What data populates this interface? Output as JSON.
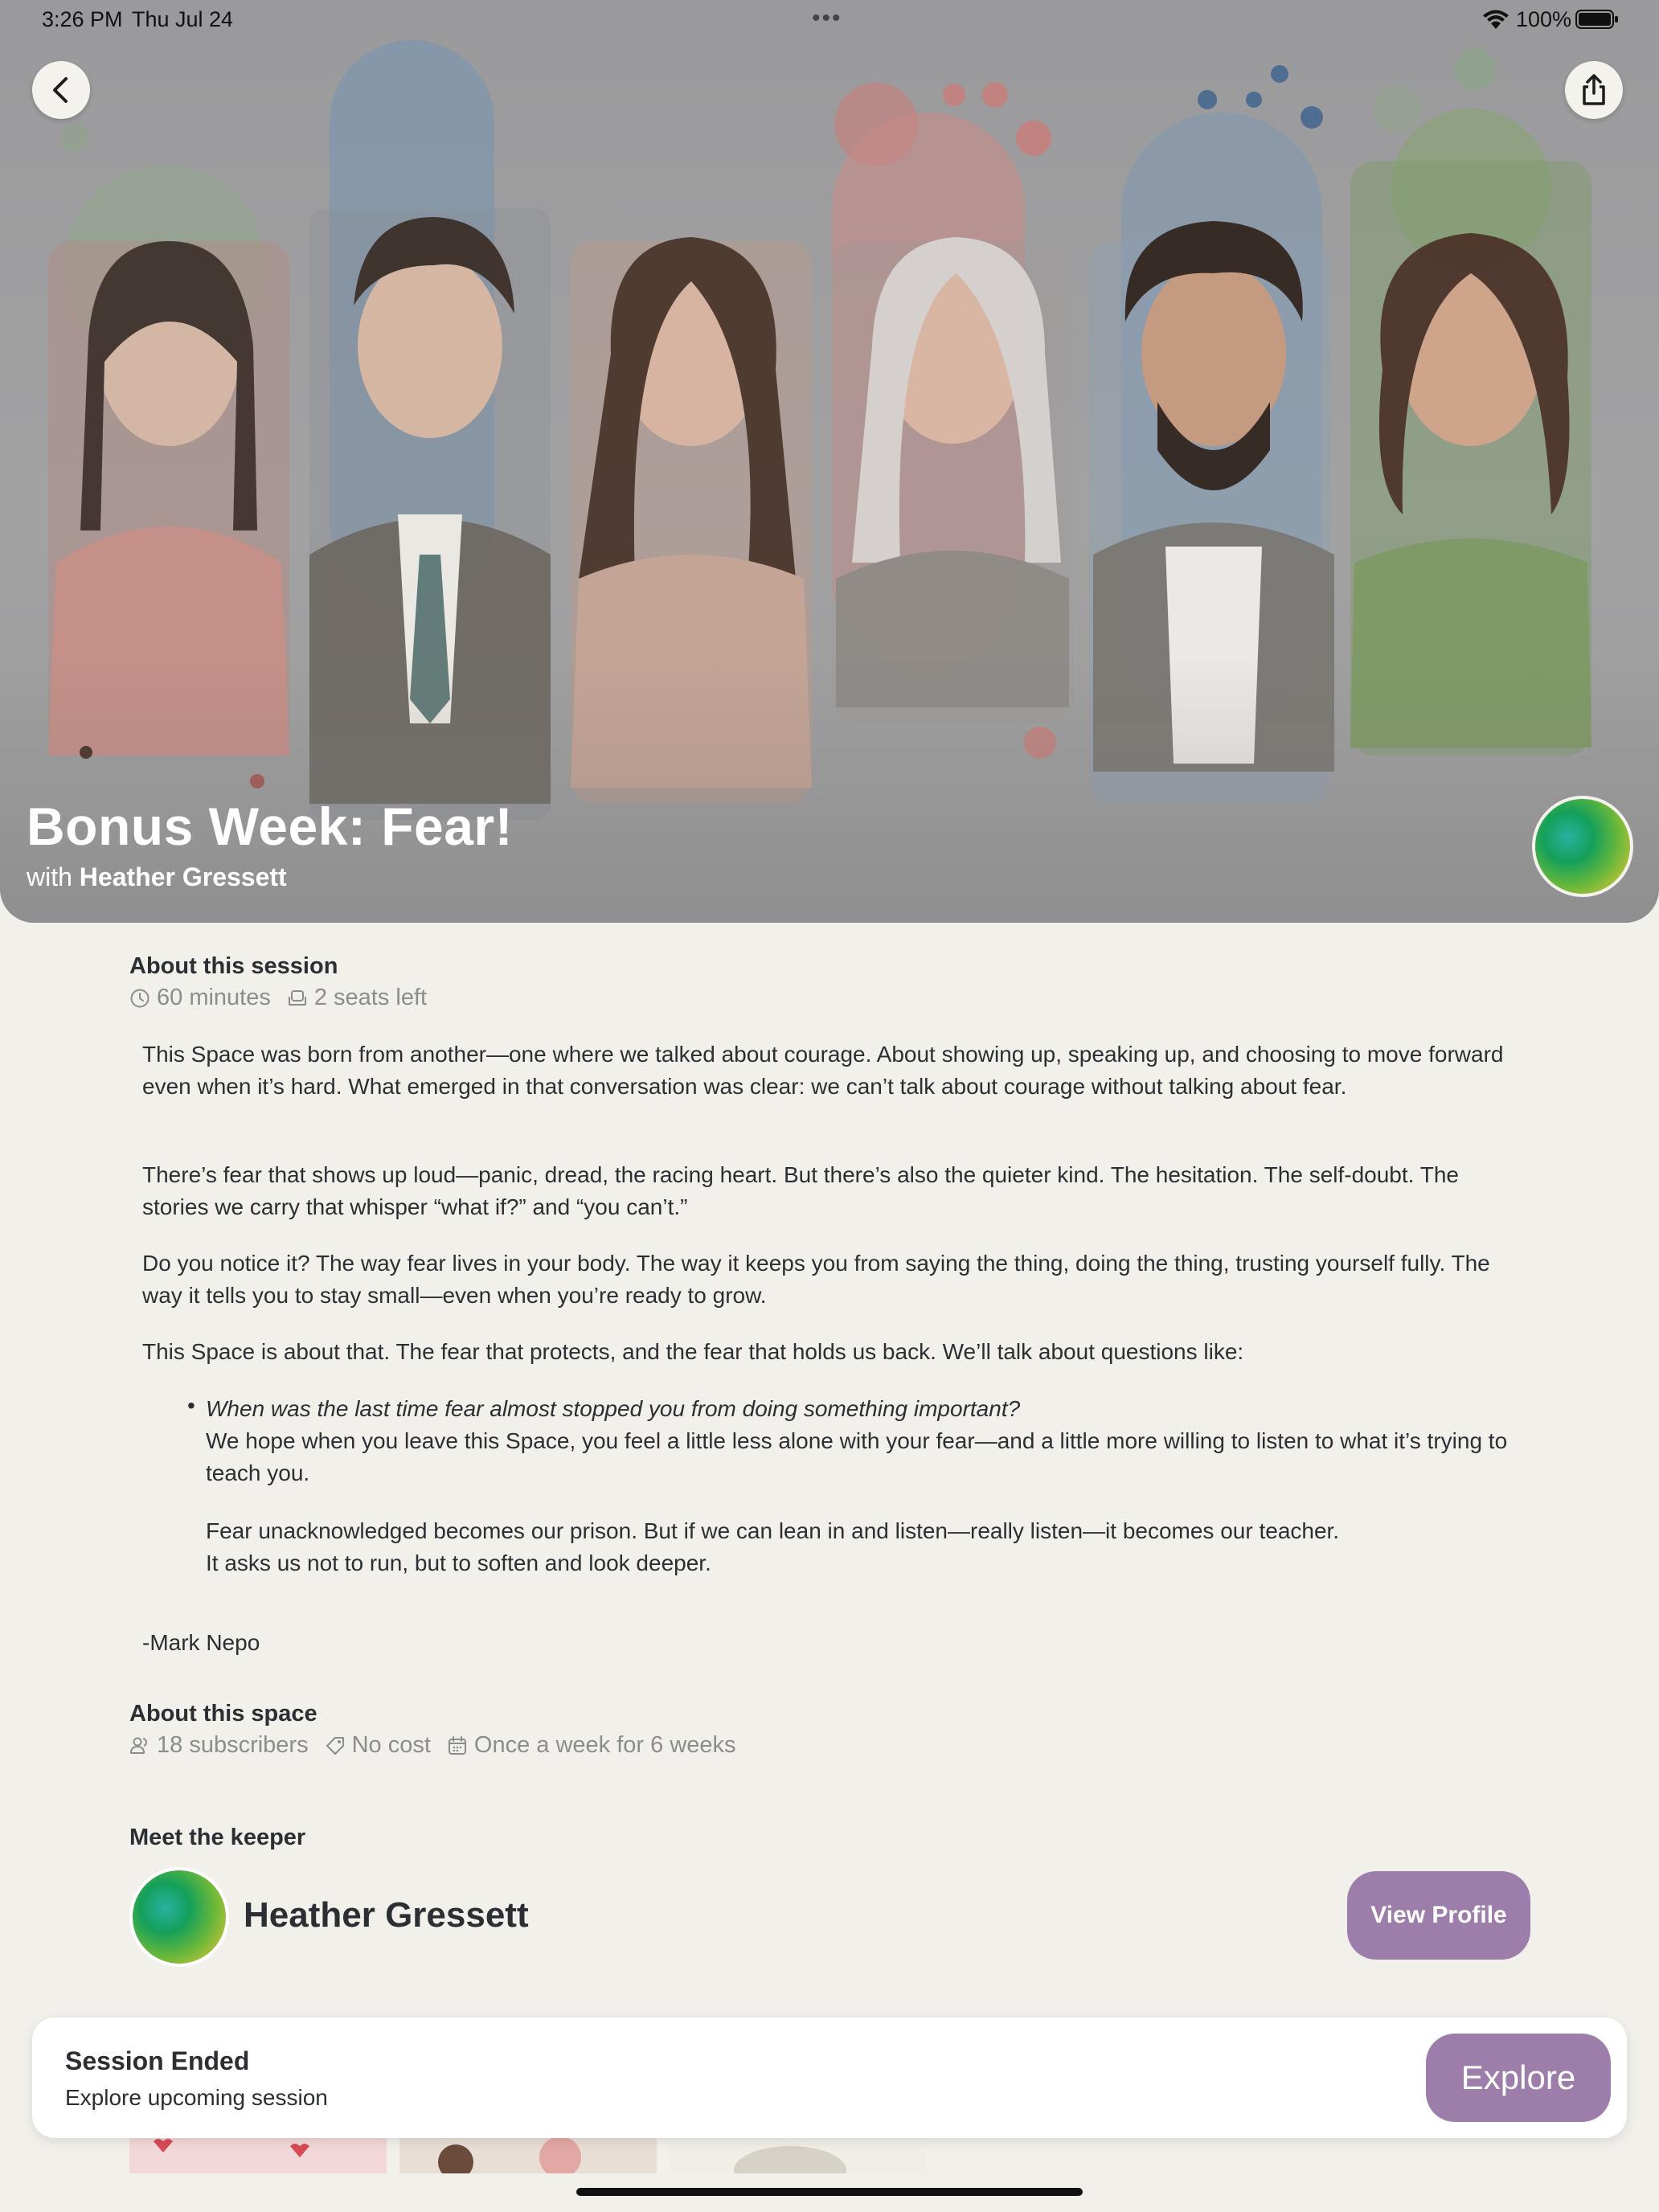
{
  "status_bar": {
    "time": "3:26 PM",
    "date": "Thu Jul 24",
    "dots": "•••",
    "battery_pct": "100%"
  },
  "hero": {
    "title": "Bonus Week: Fear!",
    "with_prefix": "with ",
    "host_name": "Heather Gressett"
  },
  "about_session": {
    "heading": "About this session",
    "duration": "60 minutes",
    "seats": "2 seats left",
    "paragraphs": [
      "This Space was born from another—one where we talked about courage. About showing up, speaking up, and choosing to move forward even when it’s hard. What emerged in that conversation was clear: we can’t talk about courage without talking about fear.",
      "There’s fear that shows up loud—panic, dread, the racing heart. But there’s also the quieter kind. The hesitation. The self-doubt. The stories we carry that whisper “what if?” and “you can’t.”",
      "Do you notice it? The way fear lives in your body. The way it keeps you from saying the thing, doing the thing, trusting yourself fully. The way it tells you to stay small—even when you’re ready to grow.",
      "This Space is about that. The fear that protects, and the fear that holds us back. We’ll talk about questions like:"
    ],
    "bullet_question": "When was the last time fear almost stopped you from doing something important?",
    "bullet_followup": "We hope when you leave this Space, you feel a little less alone with your fear—and a little more willing to listen to what it’s trying to teach you.",
    "quote_line1": "Fear unacknowledged becomes our prison. But if we can lean in and listen—really listen—it becomes our teacher.",
    "quote_line2": "It asks us not to run, but to soften and look deeper.",
    "attribution": "-Mark Nepo"
  },
  "about_space": {
    "heading": "About this space",
    "subscribers": "18 subscribers",
    "cost": "No cost",
    "schedule": "Once a week for 6 weeks"
  },
  "keeper": {
    "heading": "Meet the keeper",
    "name": "Heather Gressett",
    "view_profile_label": "View Profile"
  },
  "banner": {
    "title": "Session Ended",
    "subtitle": "Explore upcoming session",
    "explore_label": "Explore"
  },
  "icons": {
    "back": "chevron-left-icon",
    "share": "share-icon",
    "clock": "clock-icon",
    "seat": "seat-icon",
    "subscribers": "people-icon",
    "cost": "tag-icon",
    "calendar": "calendar-icon"
  },
  "colors": {
    "background": "#f2f0ea",
    "accent": "#9d7eab",
    "text": "#2b2f33",
    "muted": "#8a8c8e"
  }
}
